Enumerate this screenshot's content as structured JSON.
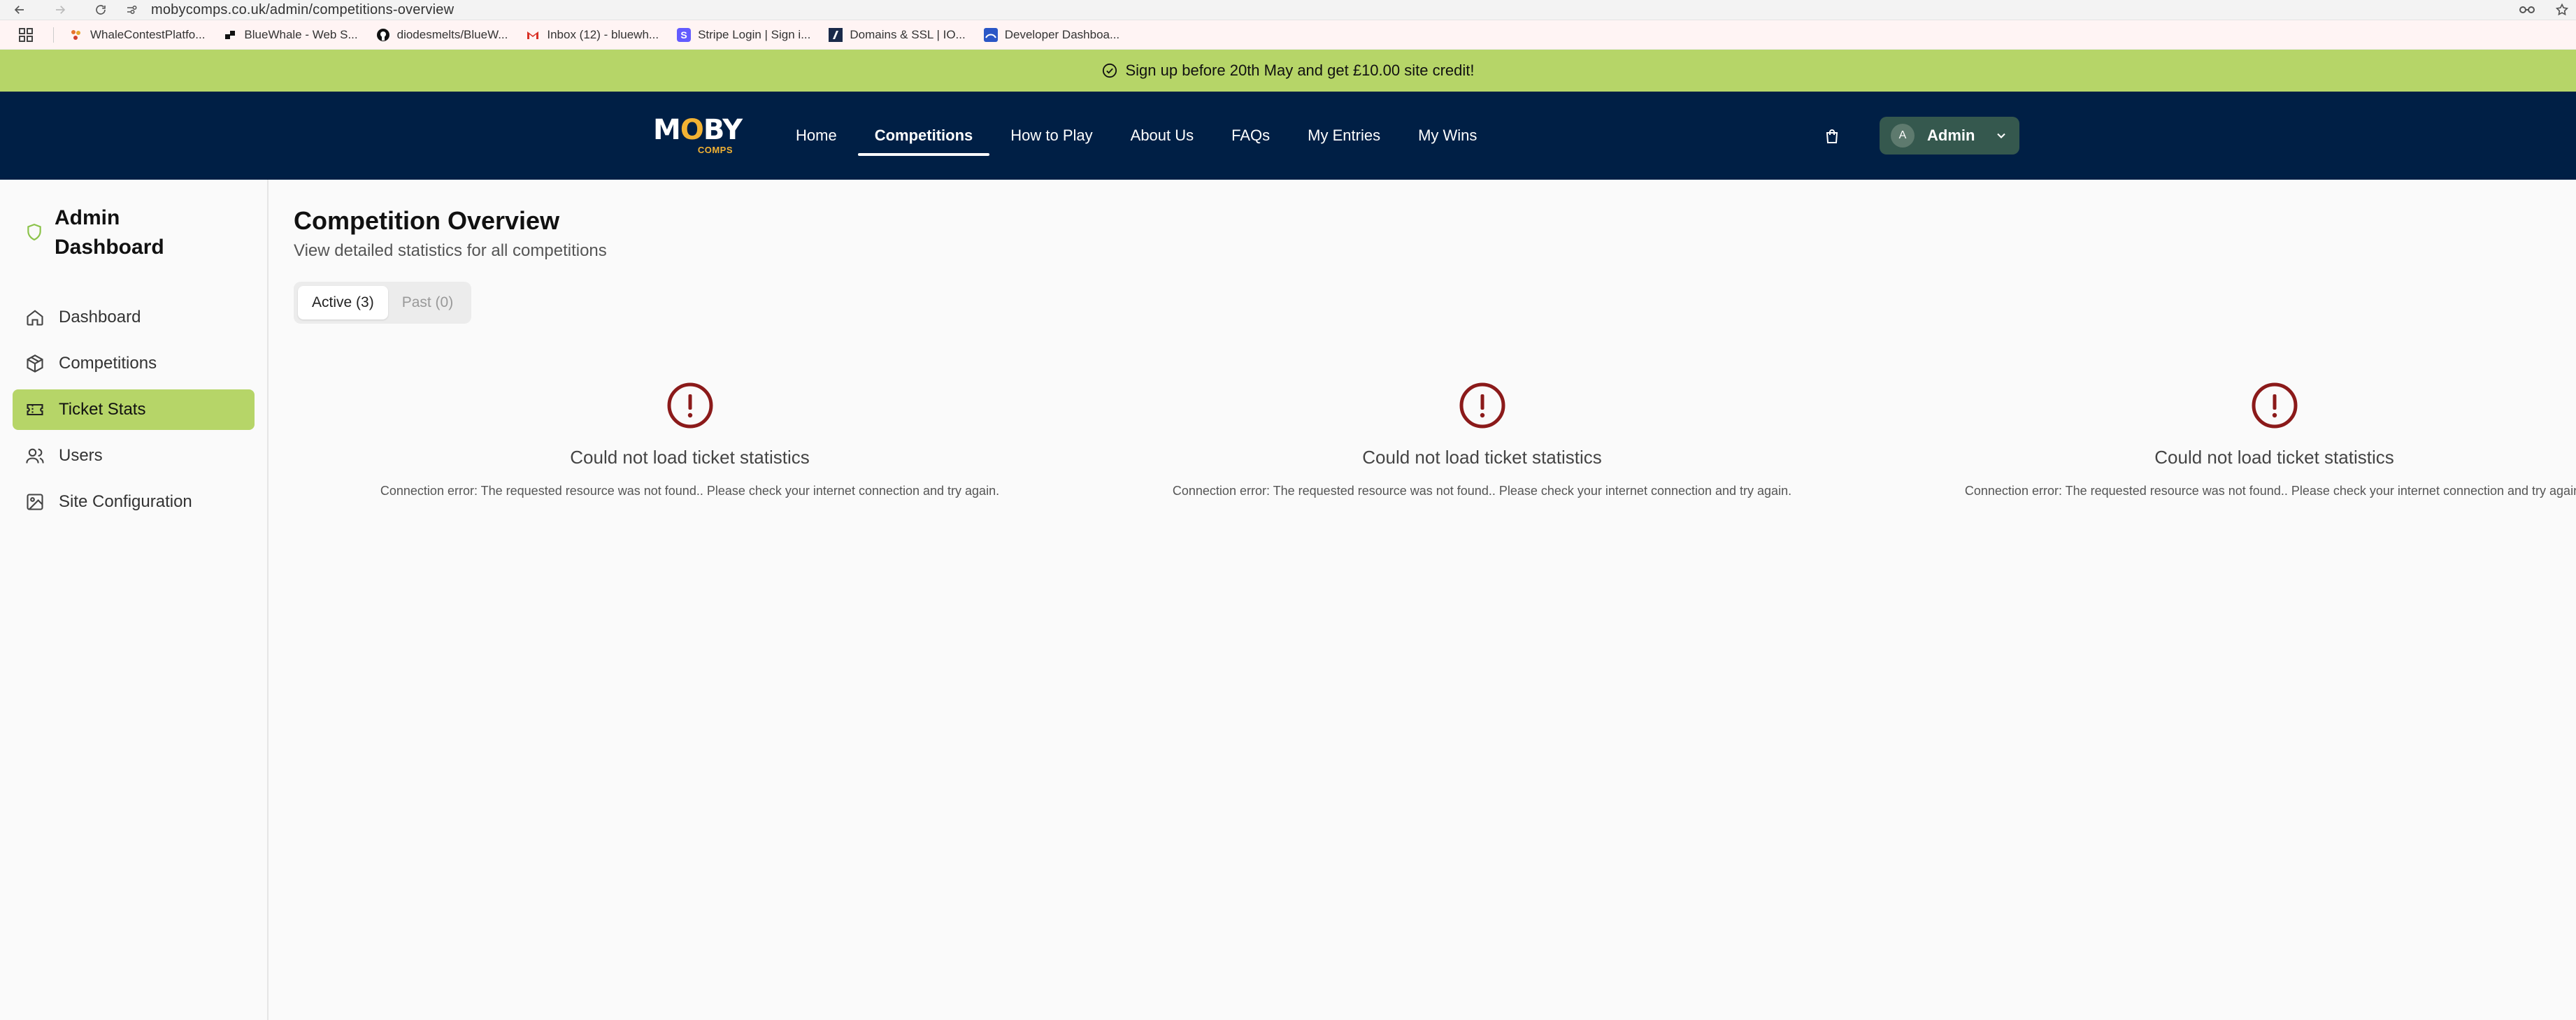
{
  "browser": {
    "url": "mobycomps.co.uk/admin/competitions-overview",
    "bookmarks": [
      {
        "label": "WhaleContestPlatfo...",
        "icon": "whale-contest-favicon-icon"
      },
      {
        "label": "BlueWhale - Web S...",
        "icon": "bluewhale-favicon-icon"
      },
      {
        "label": "diodesmelts/BlueW...",
        "icon": "github-icon"
      },
      {
        "label": "Inbox (12) - bluewh...",
        "icon": "gmail-icon"
      },
      {
        "label": "Stripe Login | Sign i...",
        "icon": "stripe-icon"
      },
      {
        "label": "Domains & SSL | IO...",
        "icon": "domains-favicon-icon"
      },
      {
        "label": "Developer Dashboa...",
        "icon": "developer-dashboard-icon"
      }
    ]
  },
  "promo": {
    "text": "Sign up before 20th May and get £10.00 site credit!"
  },
  "header": {
    "logo_main": "MOBY",
    "logo_sub": "COMPS",
    "nav": [
      {
        "label": "Home",
        "active": false
      },
      {
        "label": "Competitions",
        "active": true
      },
      {
        "label": "How to Play",
        "active": false
      },
      {
        "label": "About Us",
        "active": false
      },
      {
        "label": "FAQs",
        "active": false
      },
      {
        "label": "My Entries",
        "active": false
      },
      {
        "label": "My Wins",
        "active": false
      }
    ],
    "user": {
      "initial": "A",
      "label": "Admin"
    }
  },
  "sidebar": {
    "title": "Admin Dashboard",
    "items": [
      {
        "label": "Dashboard",
        "icon": "home-icon"
      },
      {
        "label": "Competitions",
        "icon": "box-icon"
      },
      {
        "label": "Ticket Stats",
        "icon": "ticket-icon",
        "active": true
      },
      {
        "label": "Users",
        "icon": "users-icon"
      },
      {
        "label": "Site Configuration",
        "icon": "image-icon"
      }
    ]
  },
  "main": {
    "title": "Competition Overview",
    "subtitle": "View detailed statistics for all competitions",
    "tabs": [
      {
        "label": "Active (3)",
        "active": true
      },
      {
        "label": "Past (0)",
        "active": false
      }
    ],
    "errors": [
      {
        "title": "Could not load ticket statistics",
        "message": "Connection error: The requested resource was not found.. Please check your internet connection and try again."
      },
      {
        "title": "Could not load ticket statistics",
        "message": "Connection error: The requested resource was not found.. Please check your internet connection and try again."
      },
      {
        "title": "Could not load ticket statistics",
        "message": "Connection error: The requested resource was not found.. Please check your internet connection and try again."
      }
    ]
  },
  "colors": {
    "promo_bg": "#b6d568",
    "header_bg": "#001f45",
    "accent_green": "#b6d568",
    "error_red": "#8b1a1a"
  }
}
